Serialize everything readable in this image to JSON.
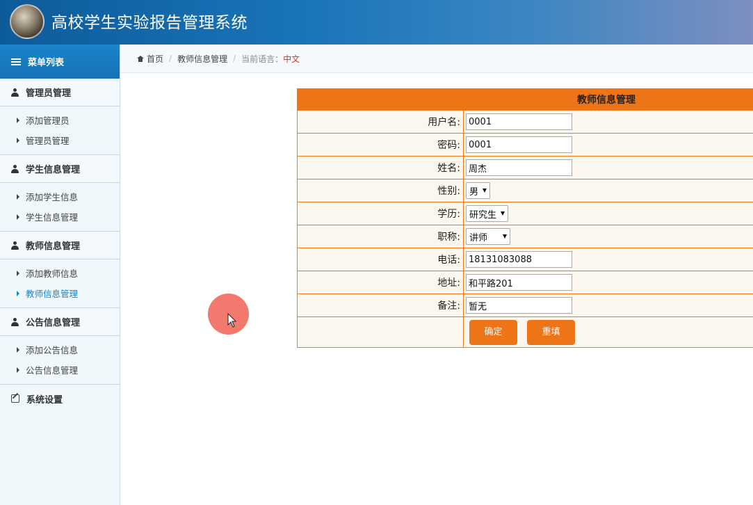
{
  "header": {
    "title": "高校学生实验报告管理系统"
  },
  "sidebar": {
    "menu_title": "菜单列表",
    "groups": [
      {
        "title": "管理员管理",
        "items": [
          "添加管理员",
          "管理员管理"
        ]
      },
      {
        "title": "学生信息管理",
        "items": [
          "添加学生信息",
          "学生信息管理"
        ]
      },
      {
        "title": "教师信息管理",
        "items": [
          "添加教师信息",
          "教师信息管理"
        ]
      },
      {
        "title": "公告信息管理",
        "items": [
          "添加公告信息",
          "公告信息管理"
        ]
      }
    ],
    "settings": "系统设置",
    "active_item": "教师信息管理"
  },
  "breadcrumb": {
    "home": "首页",
    "current": "教师信息管理",
    "lang_label": "当前语言：",
    "lang_value": "中文"
  },
  "form": {
    "title": "教师信息管理",
    "username_label": "用户名:",
    "username_value": "0001",
    "password_label": "密码:",
    "password_value": "0001",
    "name_label": "姓名:",
    "name_value": "周杰",
    "gender_label": "性别:",
    "gender_value": "男",
    "education_label": "学历:",
    "education_value": "研究生",
    "title_label": "职称:",
    "title_value": "讲师",
    "phone_label": "电话:",
    "phone_value": "18131083088",
    "address_label": "地址:",
    "address_value": "和平路201",
    "remark_label": "备注:",
    "remark_value": "暂无",
    "submit_label": "确定",
    "reset_label": "重填"
  },
  "colors": {
    "accent": "#ee7418",
    "header_blue": "#1572b5",
    "active_link": "#1a84cc"
  }
}
